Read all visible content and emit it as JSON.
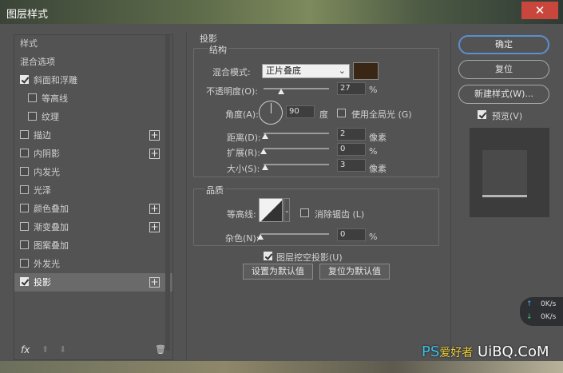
{
  "window": {
    "title": "图层样式",
    "close_glyph": "✕"
  },
  "styles_list": {
    "header": "样式",
    "items": [
      {
        "label": "混合选项",
        "checkbox": null,
        "indent": false,
        "plus": false,
        "selected": false
      },
      {
        "label": "斜面和浮雕",
        "checkbox": true,
        "indent": false,
        "plus": false,
        "selected": false
      },
      {
        "label": "等高线",
        "checkbox": false,
        "indent": true,
        "plus": false,
        "selected": false
      },
      {
        "label": "纹理",
        "checkbox": false,
        "indent": true,
        "plus": false,
        "selected": false
      },
      {
        "label": "描边",
        "checkbox": false,
        "indent": false,
        "plus": true,
        "selected": false
      },
      {
        "label": "内阴影",
        "checkbox": false,
        "indent": false,
        "plus": true,
        "selected": false
      },
      {
        "label": "内发光",
        "checkbox": false,
        "indent": false,
        "plus": false,
        "selected": false
      },
      {
        "label": "光泽",
        "checkbox": false,
        "indent": false,
        "plus": false,
        "selected": false
      },
      {
        "label": "颜色叠加",
        "checkbox": false,
        "indent": false,
        "plus": true,
        "selected": false
      },
      {
        "label": "渐变叠加",
        "checkbox": false,
        "indent": false,
        "plus": true,
        "selected": false
      },
      {
        "label": "图案叠加",
        "checkbox": false,
        "indent": false,
        "plus": false,
        "selected": false
      },
      {
        "label": "外发光",
        "checkbox": false,
        "indent": false,
        "plus": false,
        "selected": false
      },
      {
        "label": "投影",
        "checkbox": true,
        "indent": false,
        "plus": true,
        "selected": true
      }
    ],
    "footer": {
      "fx": "fx",
      "up": "⬆",
      "down": "⬇",
      "trash": "🗑"
    }
  },
  "drop_shadow": {
    "section_title": "投影",
    "structure_title": "结构",
    "blend_mode_label": "混合模式:",
    "blend_mode_value": "正片叠底",
    "shadow_color": "#3a2614",
    "opacity_label": "不透明度(O):",
    "opacity_value": "27",
    "opacity_unit": "%",
    "angle_label": "角度(A):",
    "angle_value": "90",
    "angle_unit": "度",
    "global_light_label": "使用全局光 (G)",
    "global_light_checked": false,
    "distance_label": "距离(D):",
    "distance_value": "2",
    "distance_unit": "像素",
    "spread_label": "扩展(R):",
    "spread_value": "0",
    "spread_unit": "%",
    "size_label": "大小(S):",
    "size_value": "3",
    "size_unit": "像素",
    "quality_title": "品质",
    "contour_label": "等高线:",
    "antialias_label": "消除锯齿 (L)",
    "antialias_checked": false,
    "noise_label": "杂色(N):",
    "noise_value": "0",
    "noise_unit": "%",
    "knockout_label": "图层挖空投影(U)",
    "knockout_checked": true,
    "set_default_label": "设置为默认值",
    "reset_default_label": "复位为默认值"
  },
  "sliders": {
    "opacity": 0.27,
    "distance": 0.02,
    "spread": 0.0,
    "size": 0.03,
    "noise": 0.0
  },
  "right_panel": {
    "ok_label": "确定",
    "reset_label": "复位",
    "new_style_label": "新建样式(W)...",
    "preview_label": "预览(V)",
    "preview_checked": true
  },
  "net_widget": {
    "up_arrow": "↑",
    "down_arrow": "↓",
    "up_value": "0K/s",
    "down_value": "0K/s"
  },
  "watermark": {
    "prefix": "PS",
    "cn": "爱好者",
    "suffix": "UiBQ.CoM"
  },
  "colors": {
    "accent": "#5b8fd1",
    "close": "#c9463d",
    "panel": "#535353"
  }
}
